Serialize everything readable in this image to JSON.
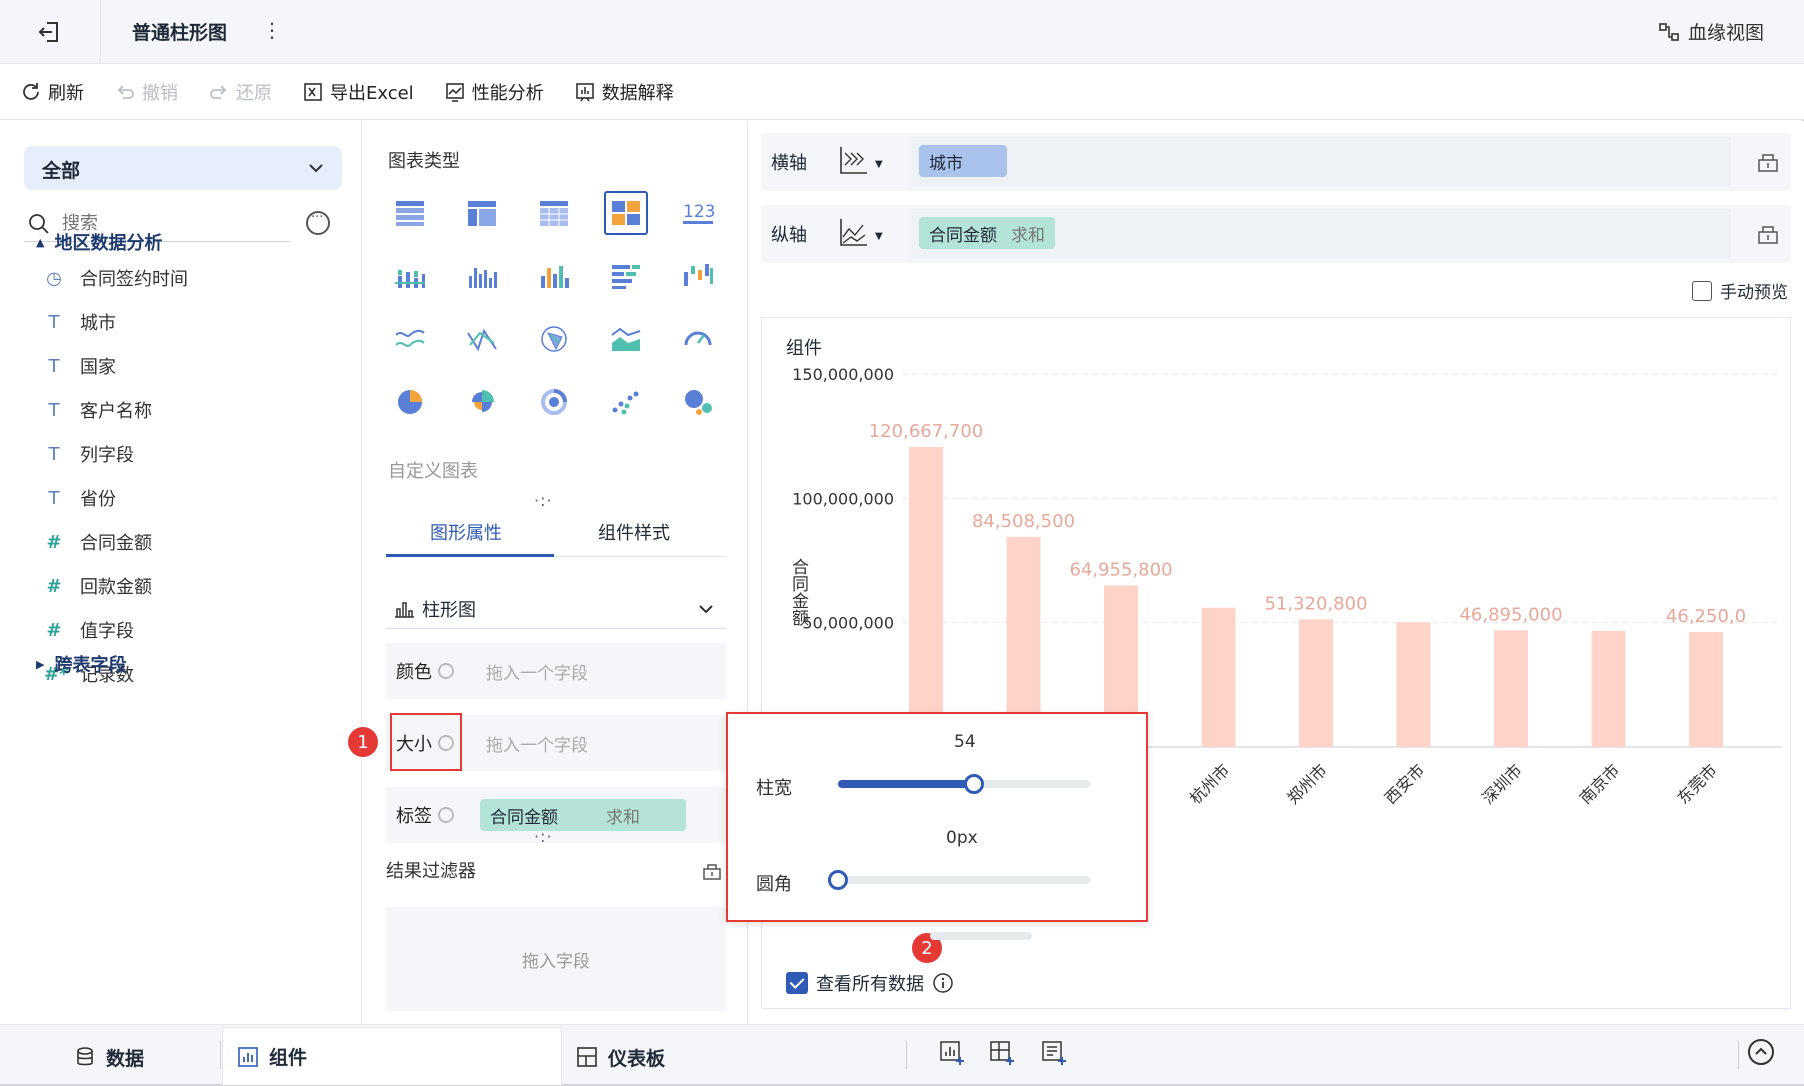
{
  "header": {
    "title": "普通柱形图",
    "lineage": "血缘视图"
  },
  "toolbar": {
    "refresh": "刷新",
    "undo": "撤销",
    "redo": "还原",
    "export": "导出Excel",
    "perf": "性能分析",
    "explain": "数据解释"
  },
  "left": {
    "scope": "全部",
    "search_placeholder": "搜索",
    "group": "地区数据分析",
    "fields": [
      {
        "label": "合同签约时间",
        "type": "time"
      },
      {
        "label": "城市",
        "type": "text"
      },
      {
        "label": "国家",
        "type": "text"
      },
      {
        "label": "客户名称",
        "type": "text"
      },
      {
        "label": "列字段",
        "type": "text"
      },
      {
        "label": "省份",
        "type": "text"
      },
      {
        "label": "合同金额",
        "type": "number"
      },
      {
        "label": "回款金额",
        "type": "number"
      },
      {
        "label": "值字段",
        "type": "number"
      },
      {
        "label": "记录数",
        "type": "number-calc"
      }
    ],
    "group2": "跨表字段"
  },
  "middle": {
    "chart_type_title": "图表类型",
    "custom_chart": "自定义图表",
    "tab_graph": "图形属性",
    "tab_style": "组件样式",
    "chart_kind": "柱形图",
    "color_label": "颜色",
    "size_label": "大小",
    "label_label": "标签",
    "drop_hint": "拖入一个字段",
    "label_field": "合同金额",
    "label_agg": "求和",
    "filter_title": "结果过滤器",
    "filter_drop": "拖入字段",
    "badge1": "1"
  },
  "right": {
    "x_axis_label": "横轴",
    "y_axis_label": "纵轴",
    "x_field": "城市",
    "y_field": "合同金额",
    "y_agg": "求和",
    "manual_preview": "手动预览",
    "chart_title": "组件",
    "view_all": "查看所有数据",
    "badge2": "2"
  },
  "popover": {
    "bar_width_label": "柱宽",
    "bar_width_value": "54",
    "bar_width_fraction": 0.54,
    "radius_label": "圆角",
    "radius_value": "0px",
    "radius_fraction": 0.0
  },
  "bottom": {
    "data": "数据",
    "component": "组件",
    "dashboard": "仪表板"
  },
  "colors": {
    "accent": "#2f5bb7",
    "bar": "#ffd3c8",
    "label": "#e8a89a",
    "highlight": "#e53935"
  },
  "chart_data": {
    "type": "bar",
    "ylabel": "合同金额",
    "ylim": [
      0,
      150000000
    ],
    "yticks": [
      "150,000,000",
      "100,000,000",
      "50,000,000"
    ],
    "ytick_values": [
      150000000,
      100000000,
      50000000
    ],
    "categories": [
      "",
      "",
      "",
      "杭州市",
      "郑州市",
      "西安市",
      "深圳市",
      "南京市",
      "东莞市"
    ],
    "values": [
      120667700,
      84508500,
      64955800,
      56000000,
      51320800,
      50200000,
      46895000,
      46700000,
      46250000
    ],
    "data_labels": [
      "120,667,700",
      "84,508,500",
      "64,955,800",
      "",
      "51,320,800",
      "",
      "46,895,000",
      "",
      "46,250,0"
    ]
  }
}
